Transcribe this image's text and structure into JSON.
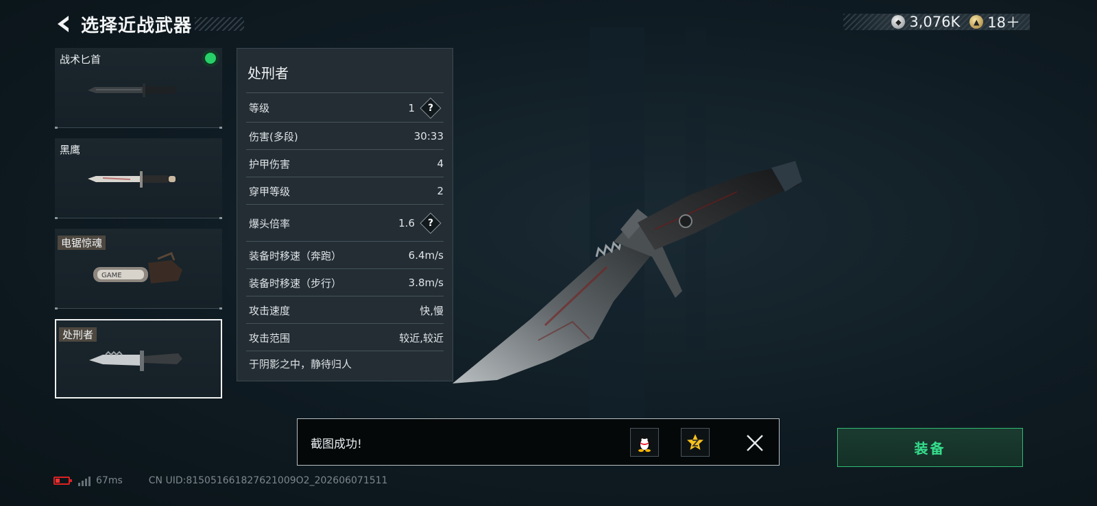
{
  "header": {
    "title": "选择近战武器"
  },
  "currency": [
    {
      "icon": "silver-coin-icon",
      "value": "3,076K"
    },
    {
      "icon": "gold-coin-icon",
      "value": "18＋"
    }
  ],
  "weapons": [
    {
      "name": "战术匕首",
      "equipped": true,
      "selected": false
    },
    {
      "name": "黑鹰",
      "equipped": false,
      "selected": false
    },
    {
      "name": "电锯惊魂",
      "equipped": false,
      "selected": false
    },
    {
      "name": "处刑者",
      "equipped": false,
      "selected": true
    }
  ],
  "stats": {
    "title": "处刑者",
    "rows": [
      {
        "label": "等级",
        "value": "1",
        "help": true
      },
      {
        "label": "伤害(多段)",
        "value": "30:33"
      },
      {
        "label": "护甲伤害",
        "value": "4"
      },
      {
        "label": "穿甲等级",
        "value": "2"
      },
      {
        "label": "爆头倍率",
        "value": "1.6",
        "help": true
      },
      {
        "label": "装备时移速（奔跑）",
        "value": "6.4m/s"
      },
      {
        "label": "装备时移速（步行）",
        "value": "3.8m/s"
      },
      {
        "label": "攻击速度",
        "value": "快,慢"
      },
      {
        "label": "攻击范围",
        "value": "较近,较近"
      }
    ],
    "motto": "于阴影之中，静待归人"
  },
  "toast": {
    "message": "截图成功!"
  },
  "equip_button": {
    "label": "装备"
  },
  "footer": {
    "ping": "67ms",
    "uid": "CN UID:815051661827621009O2_202606071511"
  },
  "colors": {
    "accent_green": "#35e08d",
    "equipped_dot": "#28d06a",
    "battery_low": "#e33"
  }
}
